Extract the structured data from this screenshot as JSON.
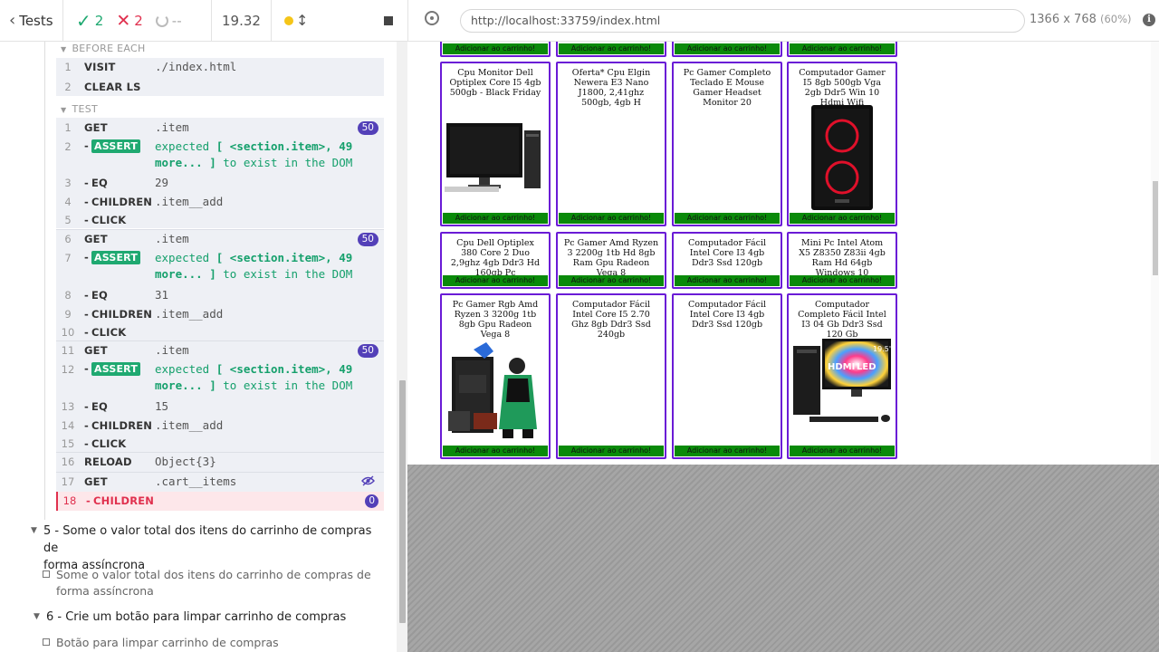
{
  "reporter": {
    "tests_label": "Tests",
    "passed": "2",
    "failed": "2",
    "pending": "--",
    "duration": "19.32"
  },
  "runner": {
    "url": "http://localhost:33759/index.html",
    "viewport": "1366 x 768",
    "scale": "(60%)"
  },
  "hooks": {
    "before_each": "BEFORE EACH",
    "test": "TEST"
  },
  "before_each_commands": [
    {
      "num": "1",
      "name": "VISIT",
      "msg": "./index.html"
    },
    {
      "num": "2",
      "name": "CLEAR LS",
      "msg": ""
    }
  ],
  "test_commands": [
    {
      "num": "1",
      "name": "GET",
      "msg": ".item",
      "badge": "50"
    },
    {
      "num": "2",
      "name": "ASSERT",
      "msg_a": "expected",
      "msg_b": "[ <section.item>, 49",
      "msg_c": "more... ]",
      "msg_d": "to exist in the DOM"
    },
    {
      "num": "3",
      "name": "EQ",
      "msg": "29"
    },
    {
      "num": "4",
      "name": "CHILDREN",
      "msg": ".item__add"
    },
    {
      "num": "5",
      "name": "CLICK",
      "msg": ""
    },
    {
      "num": "6",
      "name": "GET",
      "msg": ".item",
      "badge": "50"
    },
    {
      "num": "7",
      "name": "ASSERT",
      "msg_a": "expected",
      "msg_b": "[ <section.item>, 49",
      "msg_c": "more... ]",
      "msg_d": "to exist in the DOM"
    },
    {
      "num": "8",
      "name": "EQ",
      "msg": "31"
    },
    {
      "num": "9",
      "name": "CHILDREN",
      "msg": ".item__add"
    },
    {
      "num": "10",
      "name": "CLICK",
      "msg": ""
    },
    {
      "num": "11",
      "name": "GET",
      "msg": ".item",
      "badge": "50"
    },
    {
      "num": "12",
      "name": "ASSERT",
      "msg_a": "expected",
      "msg_b": "[ <section.item>, 49",
      "msg_c": "more... ]",
      "msg_d": "to exist in the DOM"
    },
    {
      "num": "13",
      "name": "EQ",
      "msg": "15"
    },
    {
      "num": "14",
      "name": "CHILDREN",
      "msg": ".item__add"
    },
    {
      "num": "15",
      "name": "CLICK",
      "msg": ""
    },
    {
      "num": "16",
      "name": "RELOAD",
      "msg": "Object{3}"
    },
    {
      "num": "17",
      "name": "GET",
      "msg": ".cart__items"
    },
    {
      "num": "18",
      "name": "CHILDREN",
      "msg": "",
      "badge": "0"
    }
  ],
  "suites": [
    {
      "title_1": "5 - Some o valor total dos itens do carrinho de compras de",
      "title_2": "forma assíncrona",
      "test_1": "Some o valor total dos itens do carrinho de compras de",
      "test_2": "forma assíncrona"
    },
    {
      "title_1": "6 - Crie um botão para limpar carrinho de compras",
      "test_1": "Botão para limpar carrinho de compras"
    }
  ],
  "products": {
    "add_label": "Adicionar ao carrinho!",
    "row1": [
      "Cpu Monitor Dell Optiplex Core I5 4gb 500gb - Black Friday",
      "Oferta* Cpu Elgin Newera E3 Nano J1800, 2,41ghz 500gb, 4gb H",
      "Pc Gamer Completo Teclado E Mouse Gamer Headset Monitor 20",
      "Computador Gamer I5 8gb 500gb Vga 2gb Ddr5 Win 10 Hdmi Wifi"
    ],
    "row2": [
      "Cpu Dell Optiplex 380 Core 2 Duo 2,9ghz 4gb Ddr3 Hd 160gb Pc",
      "Pc Gamer Amd Ryzen 3 2200g 1tb Hd 8gb Ram Gpu Radeon Vega 8",
      "Computador Fácil Intel Core I3 4gb Ddr3 Ssd 120gb",
      "Mini Pc Intel Atom X5 Z8350 Z83ii 4gb Ram Hd 64gb Windows 10"
    ],
    "row3": [
      "Pc Gamer Rgb Amd Ryzen 3 3200g 1tb 8gb Gpu Radeon Vega 8",
      "Computador Fácil Intel Core I5 2.70 Ghz 8gb Ddr3 Ssd 240gb",
      "Computador Fácil Intel Core I3 4gb Ddr3 Ssd 120gb",
      "Computador Completo Fácil Intel I3 04 Gb Ddr3 Ssd 120 Gb"
    ],
    "monitor_label": "19.5\"",
    "hdmi_label": "HDMI",
    "led_label": "LED"
  },
  "colors": {
    "pass": "#1fa971",
    "fail": "#e0304e",
    "badge": "#5340b8",
    "card_border": "#6a1bd6",
    "add_button": "#0a8a0a"
  }
}
